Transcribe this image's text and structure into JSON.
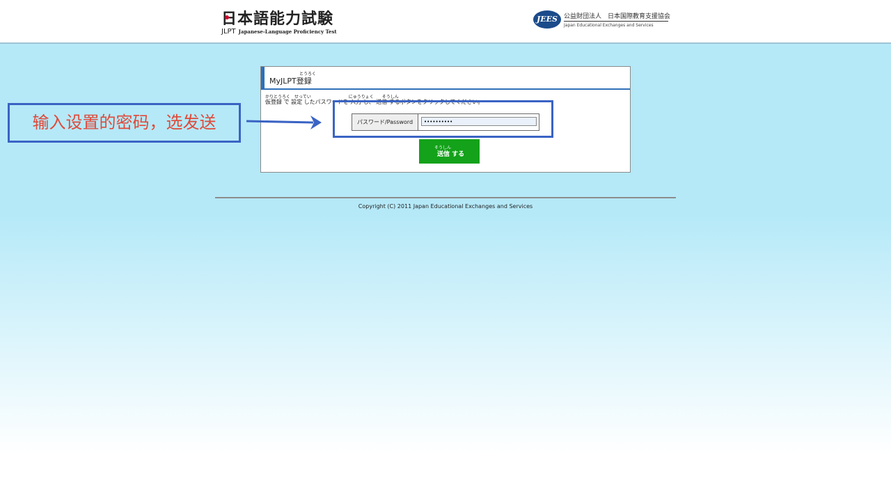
{
  "header": {
    "logo_title": "日本語能力試験",
    "logo_sub_jlpt": "JLPT",
    "logo_sub_text": "Japanese-Language Proficiency Test",
    "jees_mark": "JEES",
    "jees_jp": "公益財団法人　日本国際教育支援協会",
    "jees_en": "Japan Educational Exchanges and Services"
  },
  "panel": {
    "title": "MyJLPT登録",
    "title_ruby": "とうろく",
    "instruction": "仮登録 で 設定 したパスワードを 入力 し、 送信 するボタンをクリックしてください。",
    "instruction_ruby": "かりとうろく　せってい　　　　　　　　　にゅうりょく　　そうしん",
    "password_label": "パスワード/Password",
    "password_value": "••••••••••",
    "send_ruby": "そうしん",
    "send_label": "送信 する"
  },
  "annotation": {
    "callout_text": "输入设置的密码，选发送"
  },
  "footer": {
    "copyright": "Copyright (C) 2011  Japan Educational Exchanges and Services"
  },
  "colors": {
    "accent_blue": "#2f6fb8",
    "annotation_blue": "#3a63c4",
    "annotation_red": "#e0493a",
    "send_green": "#13a21a",
    "background_cyan": "#b5e9f8"
  }
}
